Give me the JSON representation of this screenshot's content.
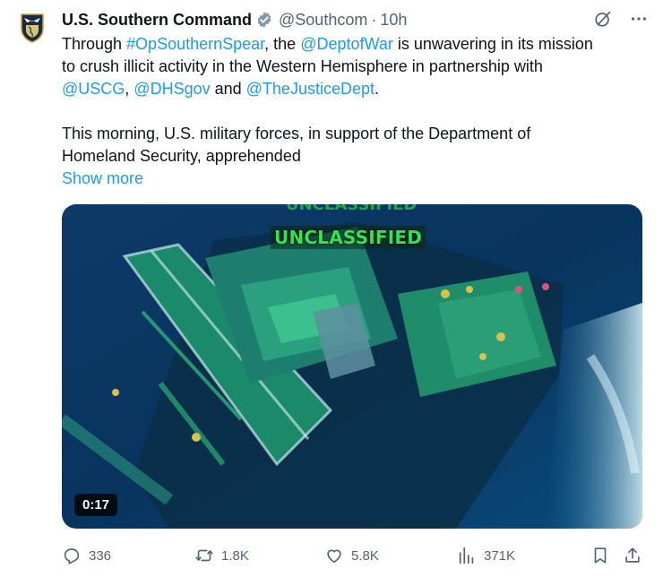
{
  "post": {
    "author_name": "U.S. Southern Command",
    "handle": "@Southcom",
    "separator": "·",
    "time": "10h",
    "body": {
      "p1_a": "Through ",
      "hashtag": "#OpSouthernSpear",
      "p1_b": ", the ",
      "mention_1": "@DeptofWar",
      "p1_c": " is unwavering in its mission",
      "p1_line2": "to crush illicit activity in the Western Hemisphere in partnership with",
      "mention_2": "@USCG",
      "p1_d": ", ",
      "mention_3": "@DHSgov",
      "p1_e": " and ",
      "mention_4": "@TheJusticeDept",
      "p1_f": ".",
      "p2_line1": "This morning, U.S. military forces, in support of the Department of",
      "p2_line2": "Homeland Security, apprehended"
    },
    "show_more": "Show more",
    "media": {
      "overlay_text": "UNCLASSIFIED",
      "overlay_text_cut": "UNCLASSIFIED",
      "duration": "0:17"
    },
    "actions": {
      "replies": "336",
      "reposts": "1.8K",
      "likes": "5.8K",
      "views": "371K"
    }
  },
  "colors": {
    "link": "#1d9bf0",
    "muted": "#536471",
    "verified_badge": "#829aab",
    "text": "#0f1419"
  }
}
